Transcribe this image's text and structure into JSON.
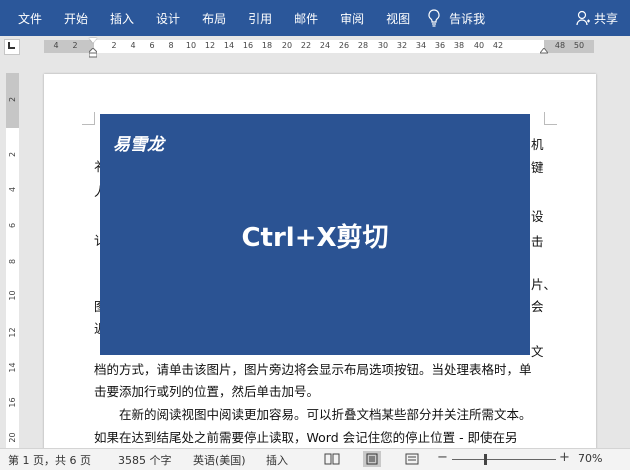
{
  "ribbon": {
    "tabs": [
      "文件",
      "开始",
      "插入",
      "设计",
      "布局",
      "引用",
      "邮件",
      "审阅",
      "视图"
    ],
    "tell_me": "告诉我",
    "share": "共享",
    "background": "#2b579a"
  },
  "ruler": {
    "h_ticks": [
      "4",
      "2",
      "2",
      "4",
      "6",
      "8",
      "10",
      "12",
      "14",
      "16",
      "18",
      "20",
      "22",
      "24",
      "26",
      "28",
      "30",
      "32",
      "34",
      "36",
      "38",
      "40",
      "42",
      "48",
      "50"
    ],
    "v_ticks": [
      "2",
      "2",
      "4",
      "6",
      "8",
      "10",
      "12",
      "14",
      "16",
      "18",
      "20"
    ]
  },
  "document": {
    "lines": [
      "档的方式，请单击该图片，图片旁边将会显示布局选项按钮。当处理表格时，单",
      "击要添加行或列的位置，然后单击加号。",
      "在新的阅读视图中阅读更加容易。可以折叠文档某些部分并关注所需文本。",
      "如果在达到结尾处之前需要停止读取，Word 会记住您的停止位置 - 即使在另"
    ],
    "left_fragments": [
      "衤",
      "人",
      "讠",
      "图",
      "近"
    ],
    "right_fragments": [
      "机",
      "键",
      "设",
      "击",
      "片、",
      "会",
      "文"
    ],
    "image": {
      "brand": "易雪龙",
      "caption": "Ctrl+X剪切",
      "background": "#2b5393"
    }
  },
  "status_bar": {
    "page": "第 1 页，共 6 页",
    "words": "3585 个字",
    "language": "英语(美国)",
    "mode": "插入",
    "zoom_out": "−",
    "zoom_in": "+",
    "zoom": "70%"
  }
}
